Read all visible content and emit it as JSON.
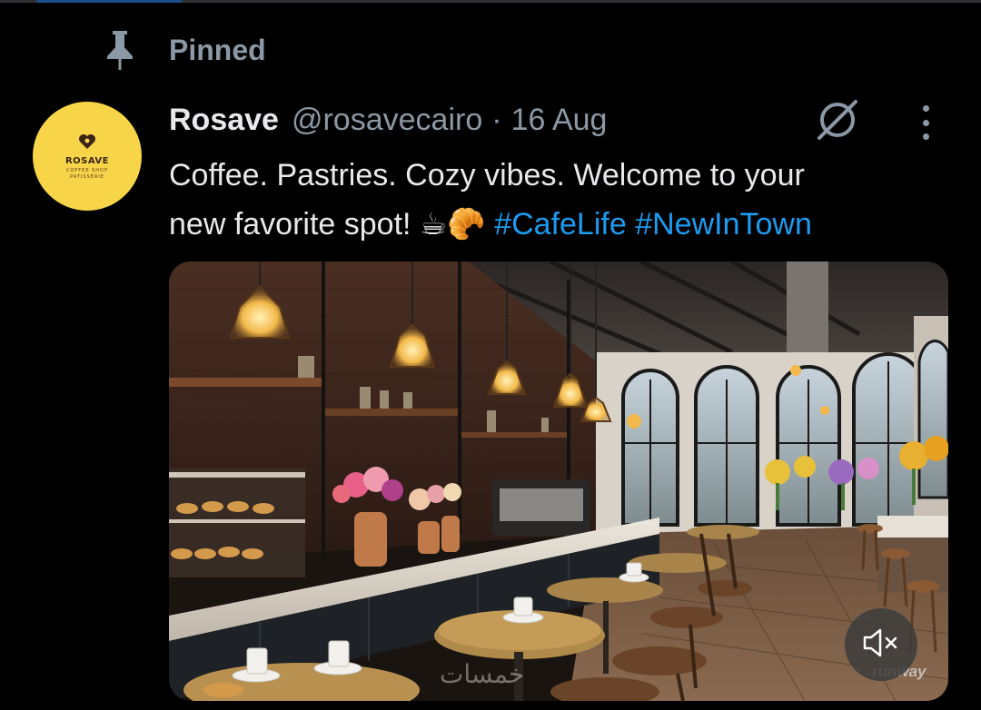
{
  "pinned": {
    "label": "Pinned",
    "icon": "pin-icon"
  },
  "author": {
    "display_name": "Rosave",
    "handle": "@rosavecairo",
    "separator": "·",
    "date": "16 Aug",
    "avatar": {
      "logo_name": "ROSAVE",
      "logo_line1": "COFFEE SHOP",
      "logo_line2": "PATISSERIE",
      "bg": "#f7d448"
    }
  },
  "tweet": {
    "text_line1": "Coffee. Pastries. Cozy vibes. Welcome to your",
    "text_line2": "new favorite spot! ",
    "emojis": "☕🥐",
    "hashtags": [
      "#CafeLife",
      "#NewInTown"
    ]
  },
  "media": {
    "watermark": "runway",
    "watermark_ar": "خمسات",
    "mute_icon": "speaker-muted-icon"
  },
  "icons": {
    "grok": "grok-icon",
    "more": "more-vertical-icon"
  },
  "colors": {
    "background": "#000000",
    "text_primary": "#e7e9ea",
    "text_secondary": "#8b98a5",
    "link": "#1d9bf0"
  }
}
